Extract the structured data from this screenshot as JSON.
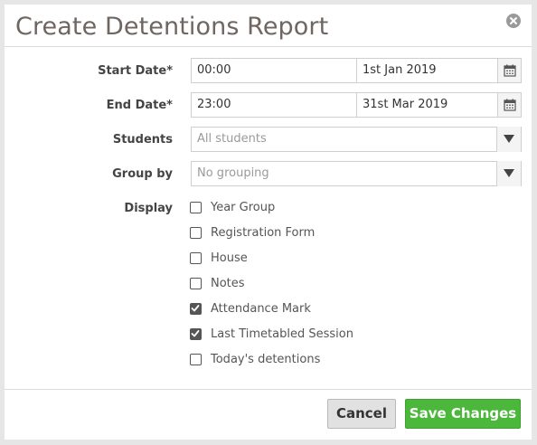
{
  "dialog": {
    "title": "Create Detentions Report",
    "close_icon": "close-circle-icon"
  },
  "form": {
    "start_date": {
      "label": "Start Date*",
      "time": "00:00",
      "date": "1st Jan 2019"
    },
    "end_date": {
      "label": "End Date*",
      "time": "23:00",
      "date": "31st Mar 2019"
    },
    "students": {
      "label": "Students",
      "value": "All students"
    },
    "group_by": {
      "label": "Group by",
      "value": "No grouping"
    },
    "display": {
      "label": "Display",
      "options": [
        {
          "label": "Year Group",
          "checked": false
        },
        {
          "label": "Registration Form",
          "checked": false
        },
        {
          "label": "House",
          "checked": false
        },
        {
          "label": "Notes",
          "checked": false
        },
        {
          "label": "Attendance Mark",
          "checked": true
        },
        {
          "label": "Last Timetabled Session",
          "checked": true
        },
        {
          "label": "Today's detentions",
          "checked": false
        }
      ]
    }
  },
  "footer": {
    "cancel_label": "Cancel",
    "save_label": "Save Changes"
  },
  "colors": {
    "save_button": "#4cb83b",
    "title_text": "#6f6662"
  }
}
